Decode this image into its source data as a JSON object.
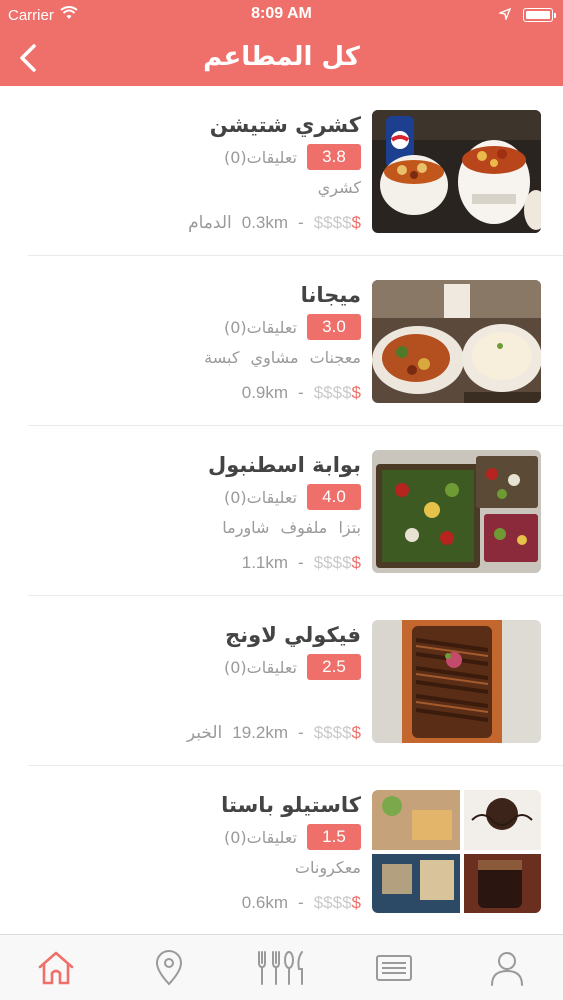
{
  "status_bar": {
    "carrier": "Carrier",
    "time": "8:09 AM"
  },
  "header": {
    "title": "كل المطاعم"
  },
  "restaurants": [
    {
      "name": "كشري شتيشن",
      "rating": "3.8",
      "reviews": "تعليقات(0)",
      "cuisines": "كشري",
      "price_active": "$",
      "price_inactive": "$$$$",
      "distance": "0.3km",
      "separator": "-",
      "city": "الدمام"
    },
    {
      "name": "ميجانا",
      "rating": "3.0",
      "reviews": "تعليقات(0)",
      "cuisines": "معجنات مشاوي كبسة",
      "price_active": "$",
      "price_inactive": "$$$$",
      "distance": "0.9km",
      "separator": "-",
      "city": ""
    },
    {
      "name": "بوابة اسطنبول",
      "rating": "4.0",
      "reviews": "تعليقات(0)",
      "cuisines": "بتزا ملفوف شاورما",
      "price_active": "$",
      "price_inactive": "$$$$",
      "distance": "1.1km",
      "separator": "-",
      "city": ""
    },
    {
      "name": "فيكولي لاونج",
      "rating": "2.5",
      "reviews": "تعليقات(0)",
      "cuisines": "",
      "price_active": "$",
      "price_inactive": "$$$$",
      "distance": "19.2km",
      "separator": "-",
      "city": "الخبر"
    },
    {
      "name": "كاستيلو باستا",
      "rating": "1.5",
      "reviews": "تعليقات(0)",
      "cuisines": "معكرونات",
      "price_active": "$",
      "price_inactive": "$$$$",
      "distance": "0.6km",
      "separator": "-",
      "city": ""
    }
  ],
  "tabbar": {
    "tabs": [
      {
        "icon": "home-icon",
        "active": true
      },
      {
        "icon": "location-pin-icon",
        "active": false
      },
      {
        "icon": "cutlery-icon",
        "active": false
      },
      {
        "icon": "menu-card-icon",
        "active": false
      },
      {
        "icon": "profile-icon",
        "active": false
      }
    ]
  },
  "colors": {
    "accent": "#ef706a",
    "text_dark": "#444444",
    "text_muted": "#9a9a9a",
    "price_inactive": "#c9c9c9"
  }
}
